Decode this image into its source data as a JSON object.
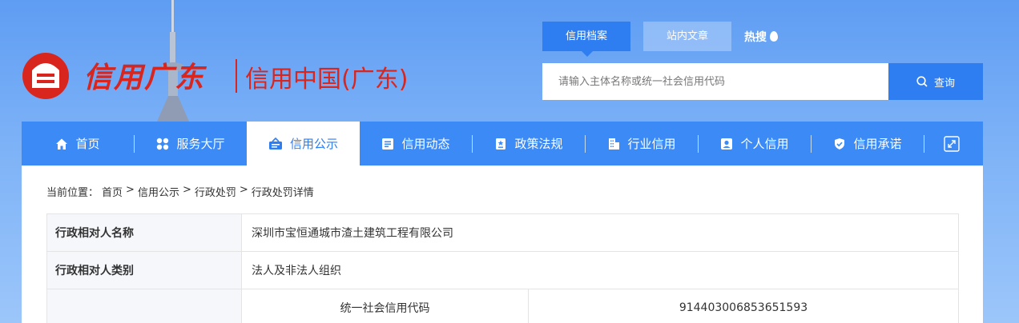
{
  "logo": {
    "brand": "信用广东",
    "subtitle": "信用中国(广东)"
  },
  "search": {
    "tabs": [
      {
        "label": "信用档案",
        "active": true
      },
      {
        "label": "站内文章",
        "active": false
      }
    ],
    "hot_label": "热搜",
    "placeholder": "请输入主体名称或统一社会信用代码",
    "button_label": "查询"
  },
  "nav": {
    "items": [
      {
        "label": "首页",
        "icon": "home-icon"
      },
      {
        "label": "服务大厅",
        "icon": "grid-icon"
      },
      {
        "label": "信用公示",
        "icon": "announce-icon",
        "active": true
      },
      {
        "label": "信用动态",
        "icon": "news-icon"
      },
      {
        "label": "政策法规",
        "icon": "policy-icon"
      },
      {
        "label": "行业信用",
        "icon": "building-icon"
      },
      {
        "label": "个人信用",
        "icon": "person-card-icon"
      },
      {
        "label": "信用承诺",
        "icon": "shield-icon"
      }
    ],
    "expand_icon": "expand-icon"
  },
  "breadcrumb": {
    "prefix": "当前位置：",
    "items": [
      "首页",
      "信用公示",
      "行政处罚",
      "行政处罚详情"
    ],
    "separator": ">"
  },
  "detail": {
    "rows": [
      {
        "label": "行政相对人名称",
        "value": "深圳市宝恒通城市渣土建筑工程有限公司"
      },
      {
        "label": "行政相对人类别",
        "value": "法人及非法人组织"
      }
    ],
    "code_row": {
      "sub_label": "统一社会信用代码",
      "sub_value": "914403006853651593"
    }
  },
  "colors": {
    "brand_red": "#d8261f",
    "accent_blue": "#2f7ef1",
    "nav_blue": "#3b8af6"
  }
}
